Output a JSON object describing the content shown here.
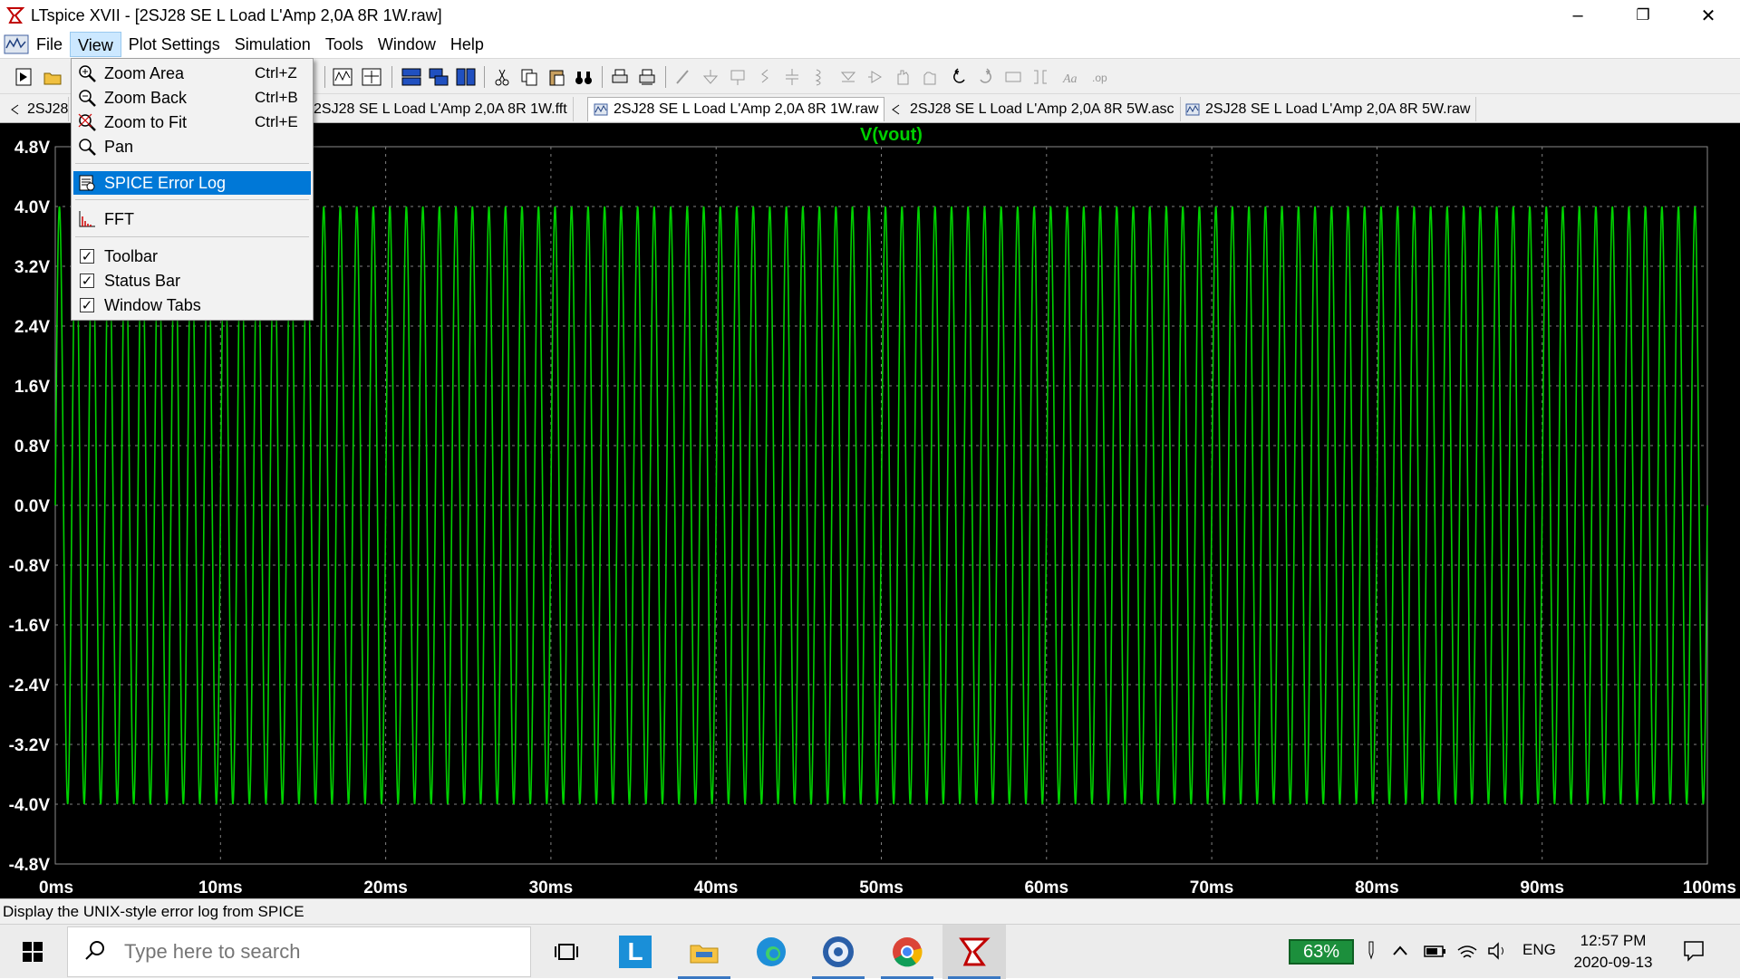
{
  "window": {
    "title": "LTspice XVII - [2SJ28 SE L Load L'Amp 2,0A 8R 1W.raw]",
    "minimize": "–",
    "maximize": "❐",
    "close": "✕",
    "mdi_minimize": "–",
    "mdi_restore": "▫",
    "mdi_close": "✕"
  },
  "menubar": {
    "items": [
      {
        "label": "File"
      },
      {
        "label": "View"
      },
      {
        "label": "Plot Settings"
      },
      {
        "label": "Simulation"
      },
      {
        "label": "Tools"
      },
      {
        "label": "Window"
      },
      {
        "label": "Help"
      }
    ]
  },
  "view_menu": {
    "items": [
      {
        "label": "Zoom Area",
        "shortcut": "Ctrl+Z",
        "icon": "zoom-area-icon"
      },
      {
        "label": "Zoom Back",
        "shortcut": "Ctrl+B",
        "icon": "zoom-back-icon"
      },
      {
        "label": "Zoom to Fit",
        "shortcut": "Ctrl+E",
        "icon": "zoom-fit-icon"
      },
      {
        "label": "Pan",
        "shortcut": "",
        "icon": "pan-icon"
      },
      {
        "label": "SPICE Error Log",
        "shortcut": "",
        "icon": "error-log-icon"
      },
      {
        "label": "FFT",
        "shortcut": "",
        "icon": "fft-icon"
      },
      {
        "label": "Toolbar",
        "shortcut": "",
        "checked": true
      },
      {
        "label": "Status Bar",
        "shortcut": "",
        "checked": true
      },
      {
        "label": "Window Tabs",
        "shortcut": "",
        "checked": true
      }
    ],
    "highlighted": "SPICE Error Log"
  },
  "tabs": [
    {
      "label": "2SJ28",
      "icon": "schematic-icon"
    },
    {
      "label": "2SJ28 SE L Load L'Amp 2,0A 8R 1W.fft",
      "icon": "waveform-icon"
    },
    {
      "label": "2SJ28 SE L Load L'Amp 2,0A 8R 1W.raw",
      "icon": "waveform-icon",
      "active": true
    },
    {
      "label": "2SJ28 SE L Load L'Amp 2,0A 8R 5W.asc",
      "icon": "schematic-icon"
    },
    {
      "label": "2SJ28 SE L Load L'Amp 2,0A 8R 5W.raw",
      "icon": "waveform-icon"
    }
  ],
  "chart_data": {
    "type": "line",
    "title": "V(vout)",
    "xlabel": "",
    "ylabel": "",
    "xlim": [
      0,
      100
    ],
    "ylim": [
      -4.8,
      4.8
    ],
    "x_ticks": [
      "0ms",
      "10ms",
      "20ms",
      "30ms",
      "40ms",
      "50ms",
      "60ms",
      "70ms",
      "80ms",
      "90ms",
      "100ms"
    ],
    "y_ticks": [
      "4.8V",
      "4.0V",
      "3.2V",
      "2.4V",
      "1.6V",
      "0.8V",
      "0.0V",
      "-0.8V",
      "-1.6V",
      "-2.4V",
      "-3.2V",
      "-4.0V",
      "-4.8V"
    ],
    "grid": true,
    "series": [
      {
        "name": "V(vout)",
        "color": "#00d000",
        "waveform": "sine",
        "amplitude_v": 4.0,
        "offset_v": 0.0,
        "frequency_hz": 1000,
        "start_s": 0.0,
        "end_s": 0.1
      }
    ]
  },
  "statusbar": {
    "text": "Display the UNIX-style error log from SPICE"
  },
  "taskbar": {
    "search_placeholder": "Type here to search",
    "battery": "63%",
    "language": "ENG",
    "time": "12:57 PM",
    "date": "2020-09-13"
  },
  "colors": {
    "plot_bg": "#000000",
    "trace": "#00d000",
    "grid": "#808080",
    "axis_text": "#ffffff",
    "highlight": "#0078d7"
  }
}
